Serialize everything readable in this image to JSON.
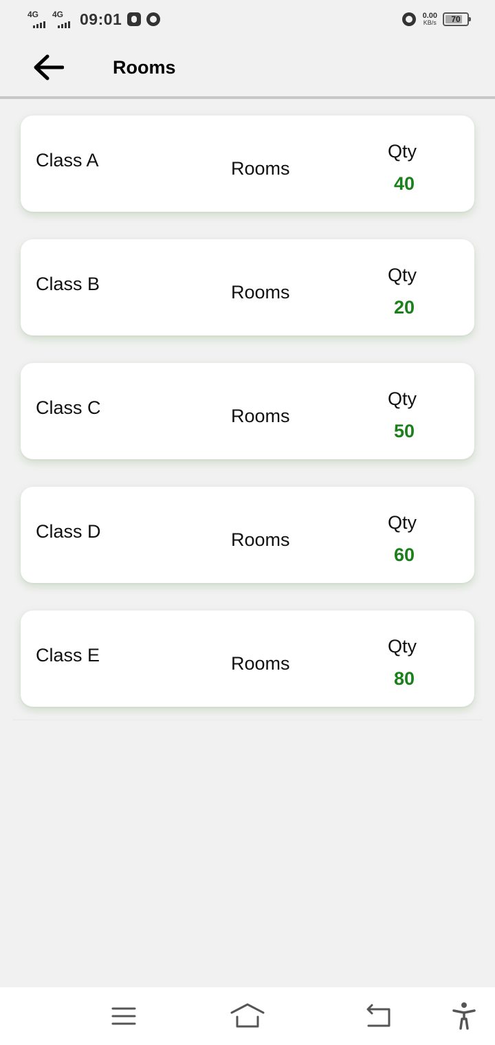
{
  "status_bar": {
    "network_1": "4G",
    "network_2": "4G",
    "time": "09:01",
    "speed_value": "0.00",
    "speed_unit": "KB/s",
    "battery_level": "70"
  },
  "header": {
    "title": "Rooms"
  },
  "rooms": [
    {
      "name": "Class A",
      "label": "Rooms",
      "qty_label": "Qty",
      "qty": "40"
    },
    {
      "name": "Class B",
      "label": "Rooms",
      "qty_label": "Qty",
      "qty": "20"
    },
    {
      "name": "Class C",
      "label": "Rooms",
      "qty_label": "Qty",
      "qty": "50"
    },
    {
      "name": "Class D",
      "label": "Rooms",
      "qty_label": "Qty",
      "qty": "60"
    },
    {
      "name": "Class E",
      "label": "Rooms",
      "qty_label": "Qty",
      "qty": "80"
    }
  ],
  "nav_bar": {
    "icons": [
      "menu-icon",
      "home-icon",
      "back-icon",
      "accessibility-icon"
    ]
  },
  "colors": {
    "accent_green": "#1b7f1b",
    "background": "#f1f1f1",
    "card": "#ffffff"
  }
}
